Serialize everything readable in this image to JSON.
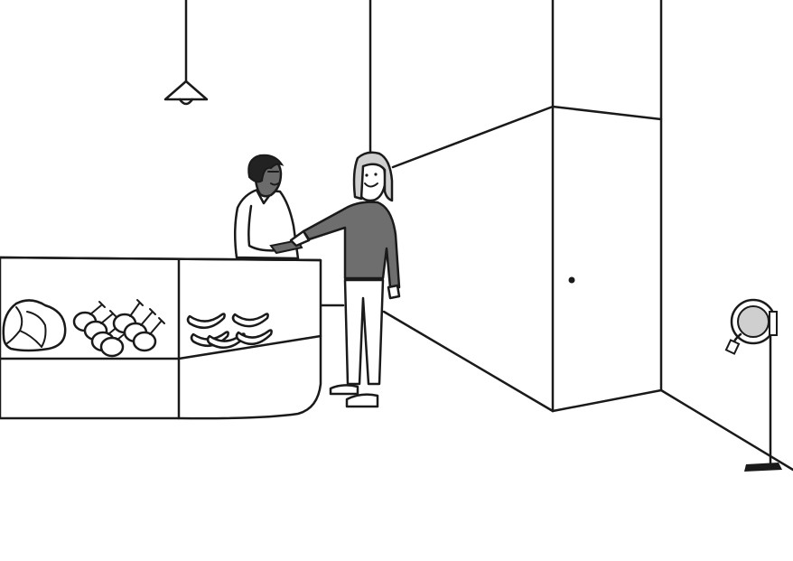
{
  "scene": {
    "description_free": true,
    "colors": {
      "line": "#1a1a1a",
      "background": "#ffffff",
      "sweater": "#6e6e6e",
      "shade_light": "#cfcfcf",
      "skin_dark": "#6b6b6b",
      "hair_dark": "#222222",
      "meat_fill": "#ffffff"
    },
    "icons": [
      "pendant-lamp-icon",
      "hose-reel-icon"
    ]
  }
}
